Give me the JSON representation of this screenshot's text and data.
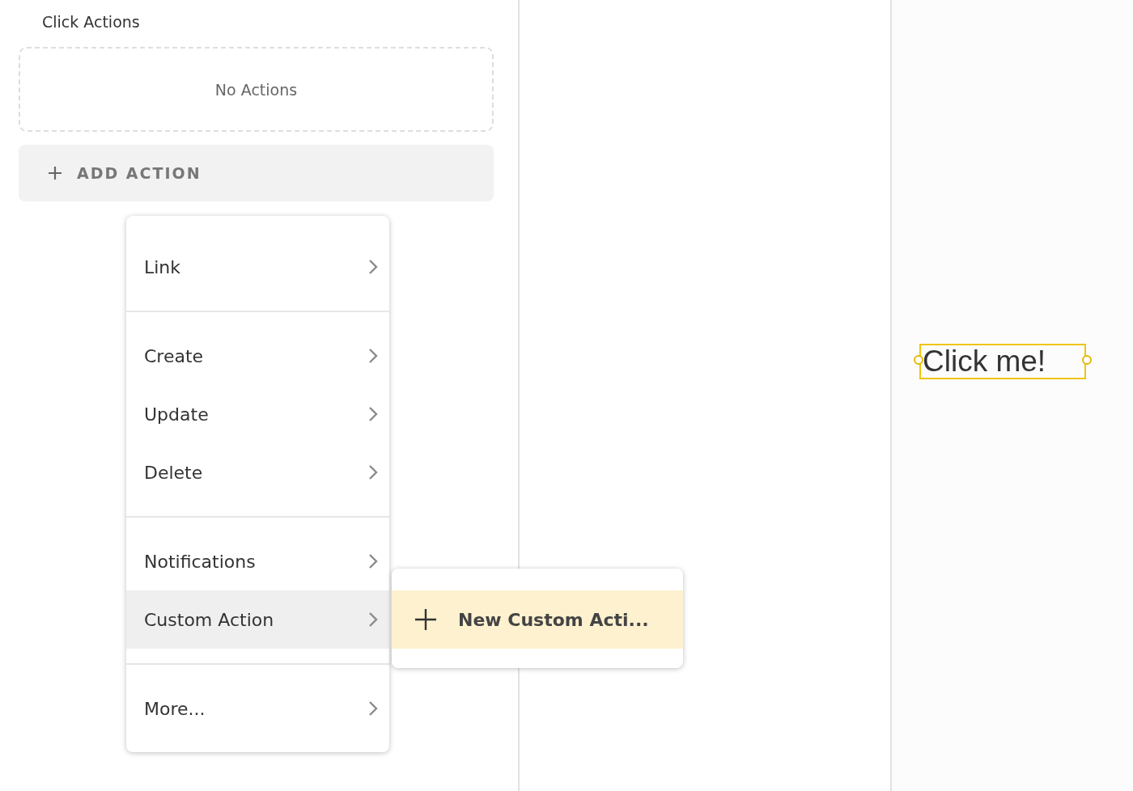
{
  "panel": {
    "title": "Click Actions",
    "empty_text": "No Actions",
    "add_button": "ADD ACTION"
  },
  "menu": {
    "groups": [
      [
        {
          "label": "Link",
          "selected": false
        }
      ],
      [
        {
          "label": "Create",
          "selected": false
        },
        {
          "label": "Update",
          "selected": false
        },
        {
          "label": "Delete",
          "selected": false
        }
      ],
      [
        {
          "label": "Notifications",
          "selected": false
        },
        {
          "label": "Custom Action",
          "selected": true
        }
      ],
      [
        {
          "label": "More...",
          "selected": false
        }
      ]
    ]
  },
  "submenu": {
    "items": [
      {
        "label": "New Custom Acti...",
        "selected": true
      }
    ]
  },
  "canvas": {
    "element": {
      "text": "Click me!",
      "selected": true
    }
  }
}
